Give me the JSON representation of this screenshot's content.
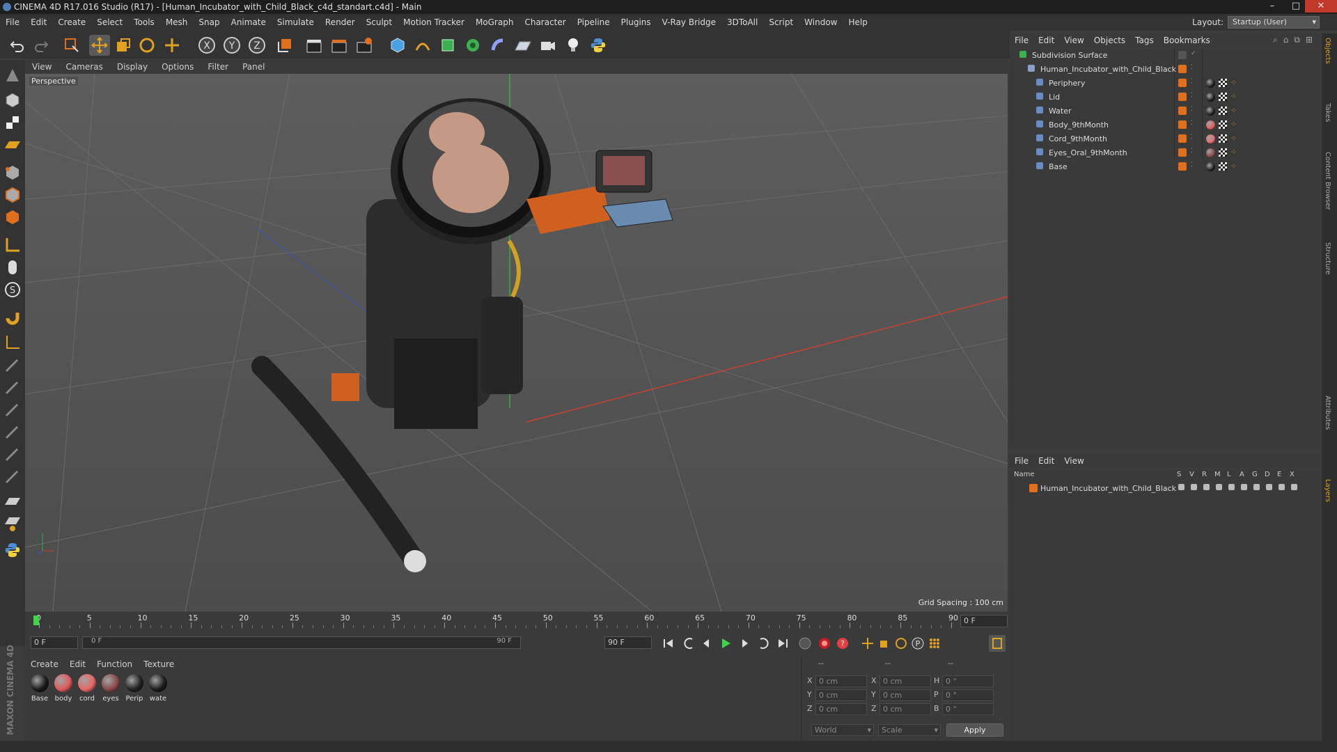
{
  "window": {
    "title": "CINEMA 4D R17.016 Studio (R17) - [Human_Incubator_with_Child_Black_c4d_standart.c4d] - Main",
    "minimize": "–",
    "maximize": "□",
    "close": "✕"
  },
  "menubar": [
    "File",
    "Edit",
    "Create",
    "Select",
    "Tools",
    "Mesh",
    "Snap",
    "Animate",
    "Simulate",
    "Render",
    "Sculpt",
    "Motion Tracker",
    "MoGraph",
    "Character",
    "Pipeline",
    "Plugins",
    "V-Ray Bridge",
    "3DToAll",
    "Script",
    "Window",
    "Help"
  ],
  "layout": {
    "label": "Layout:",
    "value": "Startup (User)"
  },
  "viewport": {
    "menu": [
      "View",
      "Cameras",
      "Display",
      "Options",
      "Filter",
      "Panel"
    ],
    "camera": "Perspective",
    "grid_spacing": "Grid Spacing : 100 cm"
  },
  "timeline": {
    "ticks": [
      "0",
      "5",
      "10",
      "15",
      "20",
      "25",
      "30",
      "35",
      "40",
      "45",
      "50",
      "55",
      "60",
      "65",
      "70",
      "75",
      "80",
      "85",
      "90"
    ],
    "current_frame": "0 F",
    "start_frame": "0 F",
    "range_start": "0 F",
    "range_end": "90 F",
    "end_frame": "90 F"
  },
  "material_manager": {
    "menu": [
      "Create",
      "Edit",
      "Function",
      "Texture"
    ],
    "materials": [
      {
        "label": "Base",
        "color": "#1a1a1a"
      },
      {
        "label": "body",
        "color": "#e05a5a"
      },
      {
        "label": "cord",
        "color": "#e86868"
      },
      {
        "label": "eyes",
        "color": "#8a4a4a"
      },
      {
        "label": "Perip",
        "color": "#222222"
      },
      {
        "label": "wate",
        "color": "#1c1c1c"
      }
    ]
  },
  "coordinates": {
    "header": [
      "--",
      "--",
      "--"
    ],
    "rows": [
      {
        "a": "X",
        "av": "0 cm",
        "b": "X",
        "bv": "0 cm",
        "c": "H",
        "cv": "0 °"
      },
      {
        "a": "Y",
        "av": "0 cm",
        "b": "Y",
        "bv": "0 cm",
        "c": "P",
        "cv": "0 °"
      },
      {
        "a": "Z",
        "av": "0 cm",
        "b": "Z",
        "bv": "0 cm",
        "c": "B",
        "cv": "0 °"
      }
    ],
    "space": "World",
    "mode": "Scale",
    "apply": "Apply"
  },
  "object_manager": {
    "menu": [
      "File",
      "Edit",
      "View",
      "Objects",
      "Tags",
      "Bookmarks"
    ],
    "objects": [
      {
        "name": "Subdivision Surface",
        "indent": 0
      },
      {
        "name": "Human_Incubator_with_Child_Black",
        "indent": 1
      },
      {
        "name": "Periphery",
        "indent": 2,
        "mat": "#1a1a1a"
      },
      {
        "name": "Lid",
        "indent": 2,
        "mat": "#1a1a1a"
      },
      {
        "name": "Water",
        "indent": 2,
        "mat": "#1a1a1a"
      },
      {
        "name": "Body_9thMonth",
        "indent": 2,
        "mat": "#e05a5a"
      },
      {
        "name": "Cord_9thMonth",
        "indent": 2,
        "mat": "#e86868"
      },
      {
        "name": "Eyes_Oral_9thMonth",
        "indent": 2,
        "mat": "#8a4a4a"
      },
      {
        "name": "Base",
        "indent": 2,
        "mat": "#1a1a1a"
      }
    ]
  },
  "layer_manager": {
    "menu": [
      "File",
      "Edit",
      "View"
    ],
    "columns": [
      "Name",
      "S",
      "V",
      "R",
      "M",
      "L",
      "A",
      "G",
      "D",
      "E",
      "X"
    ],
    "layers": [
      "Human_Incubator_with_Child_Black"
    ]
  },
  "right_tabs": [
    "Objects",
    "Takes",
    "Content Browser",
    "Structure",
    "Attributes",
    "Layers"
  ],
  "brand": "MAXON CINEMA 4D",
  "colors": {
    "accent_orange": "#e0701e",
    "timeline_green": "#3dd64a"
  }
}
